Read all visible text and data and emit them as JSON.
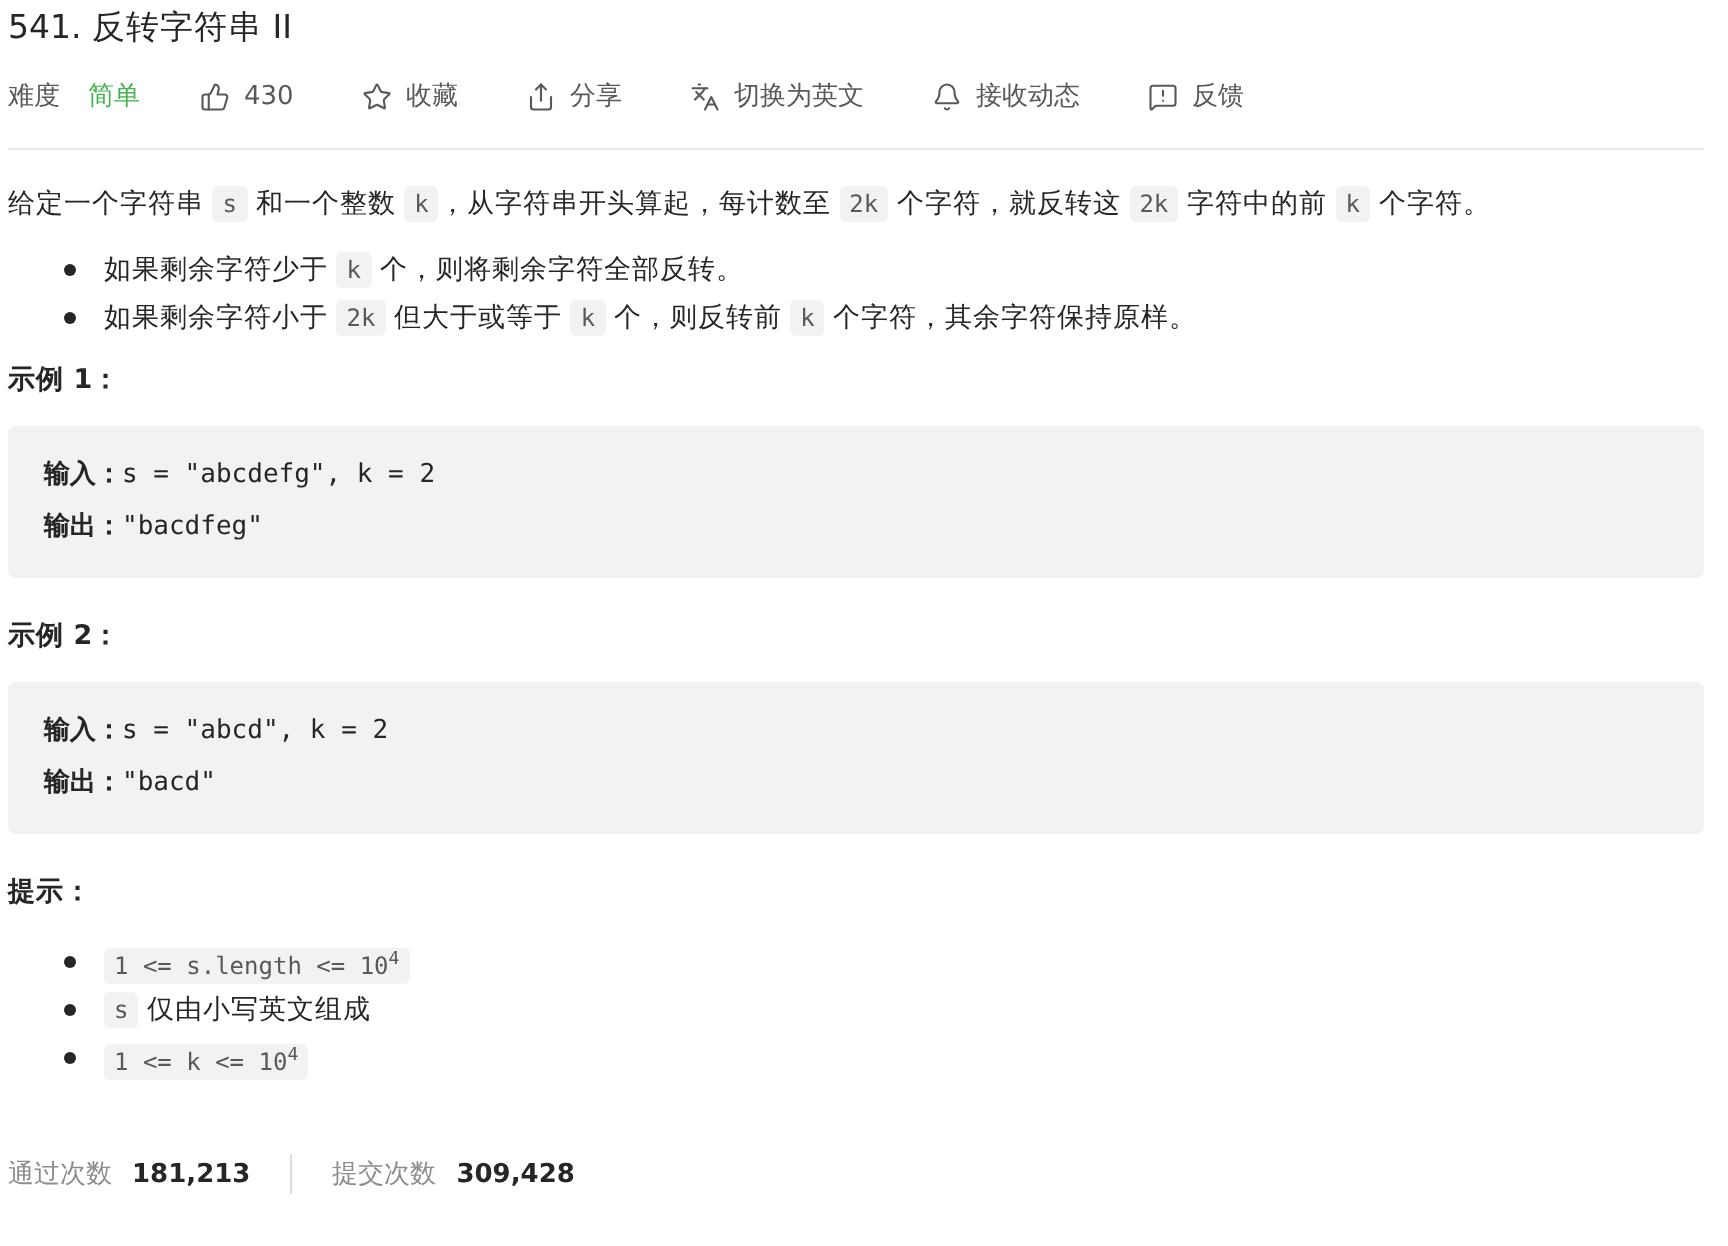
{
  "title": "541. 反转字符串 II",
  "meta": {
    "difficulty_label": "难度",
    "difficulty": "简单",
    "actions": [
      {
        "kind": "like",
        "label": "430"
      },
      {
        "kind": "star",
        "label": "收藏"
      },
      {
        "kind": "share",
        "label": "分享"
      },
      {
        "kind": "translate",
        "label": "切换为英文"
      },
      {
        "kind": "bell",
        "label": "接收动态"
      },
      {
        "kind": "feedback",
        "label": "反馈"
      }
    ]
  },
  "description": [
    {
      "kind": "text",
      "text": "给定一个字符串 "
    },
    {
      "kind": "code",
      "text": "s"
    },
    {
      "kind": "text",
      "text": " 和一个整数 "
    },
    {
      "kind": "code",
      "text": "k"
    },
    {
      "kind": "text",
      "text": "，从字符串开头算起，每计数至 "
    },
    {
      "kind": "code",
      "text": "2k"
    },
    {
      "kind": "text",
      "text": " 个字符，就反转这 "
    },
    {
      "kind": "code",
      "text": "2k"
    },
    {
      "kind": "text",
      "text": " 字符中的前 "
    },
    {
      "kind": "code",
      "text": "k"
    },
    {
      "kind": "text",
      "text": " 个字符。"
    }
  ],
  "rules": [
    [
      {
        "kind": "text",
        "text": "如果剩余字符少于 "
      },
      {
        "kind": "code",
        "text": "k"
      },
      {
        "kind": "text",
        "text": " 个，则将剩余字符全部反转。"
      }
    ],
    [
      {
        "kind": "text",
        "text": "如果剩余字符小于 "
      },
      {
        "kind": "code",
        "text": "2k"
      },
      {
        "kind": "text",
        "text": " 但大于或等于 "
      },
      {
        "kind": "code",
        "text": "k"
      },
      {
        "kind": "text",
        "text": " 个，则反转前 "
      },
      {
        "kind": "code",
        "text": "k"
      },
      {
        "kind": "text",
        "text": " 个字符，其余字符保持原样。"
      }
    ]
  ],
  "examples": [
    {
      "heading": "示例 1：",
      "lines": [
        {
          "label": "输入：",
          "value": "s = \"abcdefg\", k = 2"
        },
        {
          "label": "输出：",
          "value": "\"bacdfeg\""
        }
      ]
    },
    {
      "heading": "示例 2：",
      "lines": [
        {
          "label": "输入：",
          "value": "s = \"abcd\", k = 2"
        },
        {
          "label": "输出：",
          "value": "\"bacd\""
        }
      ]
    }
  ],
  "hints": {
    "heading": "提示：",
    "items": [
      [
        {
          "kind": "code",
          "text": "1 <= s.length <= 10$^{4}$"
        }
      ],
      [
        {
          "kind": "code",
          "text": "s"
        },
        {
          "kind": "text",
          "text": " 仅由小写英文组成"
        }
      ],
      [
        {
          "kind": "code",
          "text": "1 <= k <= 10$^{4}$"
        }
      ]
    ]
  },
  "stats": [
    {
      "label": "通过次数",
      "value": "181,213"
    },
    {
      "label": "提交次数",
      "value": "309,428"
    }
  ]
}
